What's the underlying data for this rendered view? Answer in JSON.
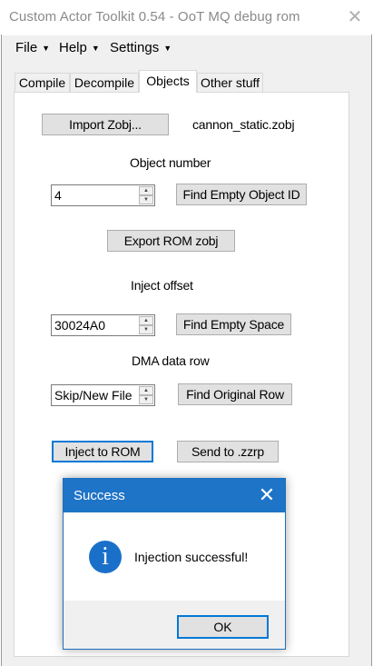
{
  "window": {
    "title": "Custom Actor Toolkit 0.54 - OoT MQ debug rom"
  },
  "menu": {
    "items": [
      {
        "label": "File"
      },
      {
        "label": "Help"
      },
      {
        "label": "Settings"
      }
    ]
  },
  "tabs": [
    {
      "label": "Compile"
    },
    {
      "label": "Decompile"
    },
    {
      "label": "Objects"
    },
    {
      "label": "Other stuff"
    }
  ],
  "active_tab": "Objects",
  "objects": {
    "import_button": "Import Zobj...",
    "file_name": "cannon_static.zobj",
    "object_number_label": "Object number",
    "object_number_value": "4",
    "find_empty_object_button": "Find Empty Object ID",
    "export_button": "Export ROM zobj",
    "inject_offset_label": "Inject offset",
    "inject_offset_value": "30024A0",
    "find_empty_space_button": "Find Empty Space",
    "dma_label": "DMA data row",
    "dma_value": "Skip/New File",
    "find_original_row_button": "Find Original Row",
    "inject_button": "Inject to ROM",
    "send_button": "Send to .zzrp"
  },
  "dialog": {
    "title": "Success",
    "message": "Injection successful!",
    "ok_label": "OK",
    "icon": "info-icon"
  }
}
